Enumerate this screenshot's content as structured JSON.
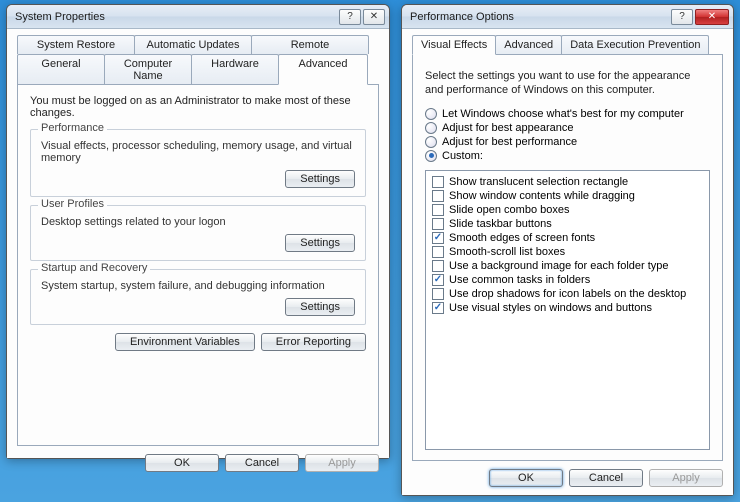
{
  "left": {
    "title": "System Properties",
    "help_icon": "?",
    "close_icon": "✕",
    "tabs_row1": [
      "System Restore",
      "Automatic Updates",
      "Remote"
    ],
    "tabs_row2": [
      "General",
      "Computer Name",
      "Hardware",
      "Advanced"
    ],
    "active_tab": "Advanced",
    "intro": "You must be logged on as an Administrator to make most of these changes.",
    "groups": [
      {
        "title": "Performance",
        "text": "Visual effects, processor scheduling, memory usage, and virtual memory",
        "button": "Settings"
      },
      {
        "title": "User Profiles",
        "text": "Desktop settings related to your logon",
        "button": "Settings"
      },
      {
        "title": "Startup and Recovery",
        "text": "System startup, system failure, and debugging information",
        "button": "Settings"
      }
    ],
    "env_button": "Environment Variables",
    "err_button": "Error Reporting",
    "ok": "OK",
    "cancel": "Cancel",
    "apply": "Apply"
  },
  "right": {
    "title": "Performance Options",
    "help_icon": "?",
    "close_icon": "✕",
    "tabs": [
      "Visual Effects",
      "Advanced",
      "Data Execution Prevention"
    ],
    "active_tab": "Visual Effects",
    "description": "Select the settings you want to use for the appearance and performance of Windows on this computer.",
    "radios": [
      {
        "label": "Let Windows choose what's best for my computer",
        "checked": false
      },
      {
        "label": "Adjust for best appearance",
        "checked": false
      },
      {
        "label": "Adjust for best performance",
        "checked": false
      },
      {
        "label": "Custom:",
        "checked": true
      }
    ],
    "checks": [
      {
        "label": "Show translucent selection rectangle",
        "checked": false
      },
      {
        "label": "Show window contents while dragging",
        "checked": false
      },
      {
        "label": "Slide open combo boxes",
        "checked": false
      },
      {
        "label": "Slide taskbar buttons",
        "checked": false
      },
      {
        "label": "Smooth edges of screen fonts",
        "checked": true
      },
      {
        "label": "Smooth-scroll list boxes",
        "checked": false
      },
      {
        "label": "Use a background image for each folder type",
        "checked": false
      },
      {
        "label": "Use common tasks in folders",
        "checked": true
      },
      {
        "label": "Use drop shadows for icon labels on the desktop",
        "checked": false
      },
      {
        "label": "Use visual styles on windows and buttons",
        "checked": true
      }
    ],
    "ok": "OK",
    "cancel": "Cancel",
    "apply": "Apply"
  }
}
